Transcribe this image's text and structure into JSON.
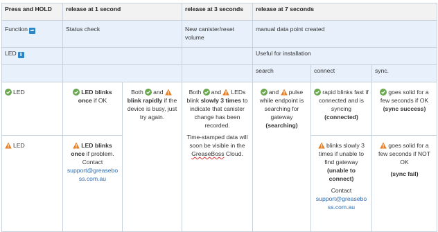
{
  "header": {
    "col1": "Press and HOLD",
    "col2": "release at 1 second",
    "col3": "release at 3 seconds",
    "col4": "release at 7 seconds"
  },
  "function_row": {
    "label": "Function",
    "col2": "Status check",
    "col3": "New canister/reset volume",
    "col4_line1": "manual data point created",
    "col4_line2": "Useful for installation"
  },
  "led_row": {
    "label": "LED"
  },
  "sub_headers": {
    "search": "search",
    "connect": "connect",
    "sync": "sync."
  },
  "ok_row": {
    "led_label": "LED",
    "status_part1": "LED blinks",
    "status_part2": "once",
    "status_part3": "if OK",
    "both_part1": "Both",
    "both_part2": "and",
    "both_part3": "blink rapidly",
    "both_part4": "if the device is busy, just try again.",
    "reset_part1": "Both",
    "reset_part2": "and",
    "reset_part3": "LEDs blink",
    "reset_part4": "slowly 3 times",
    "reset_part5": "to indicate that canister change has been recorded.",
    "reset_note": "Time-stamped data will soon be visible in the",
    "reset_note_brand": "GreaseBoss",
    "reset_note_end": "Cloud.",
    "search_part1": "and",
    "search_part2": "pulse while endpoint is searching for gateway",
    "search_bold": "(searching)",
    "connect_part1": "rapid blinks fast if connected and is syncing",
    "connect_bold": "(connected)",
    "sync_part1": "goes solid for a few seconds if OK",
    "sync_bold": "(sync success)"
  },
  "warn_row": {
    "led_label": "LED",
    "status_part1": "LED blinks",
    "status_part2": "once",
    "status_part3": "if problem.",
    "contact": "Contact",
    "email": "support@greasebo ss.com.au",
    "connect_part1": "blinks slowly 3 times if unable to find gateway",
    "connect_bold": "(unable to connect)",
    "connect_contact": "Contact",
    "connect_email": "support@greasebo ss.com.au",
    "sync_part1": "goes solid for a few seconds if NOT OK",
    "sync_bold": "(sync fail)"
  },
  "icons": {
    "ok": "check-circle-icon",
    "warn": "warning-triangle-icon",
    "right": "arrow-right-icon",
    "down": "arrow-down-icon"
  },
  "colors": {
    "ok_green": "#6aa84f",
    "warn_orange": "#e67e22",
    "accent_blue": "#2b86c8",
    "header_bg": "#f2f2f2",
    "blue_bg": "#e8f1fb"
  }
}
